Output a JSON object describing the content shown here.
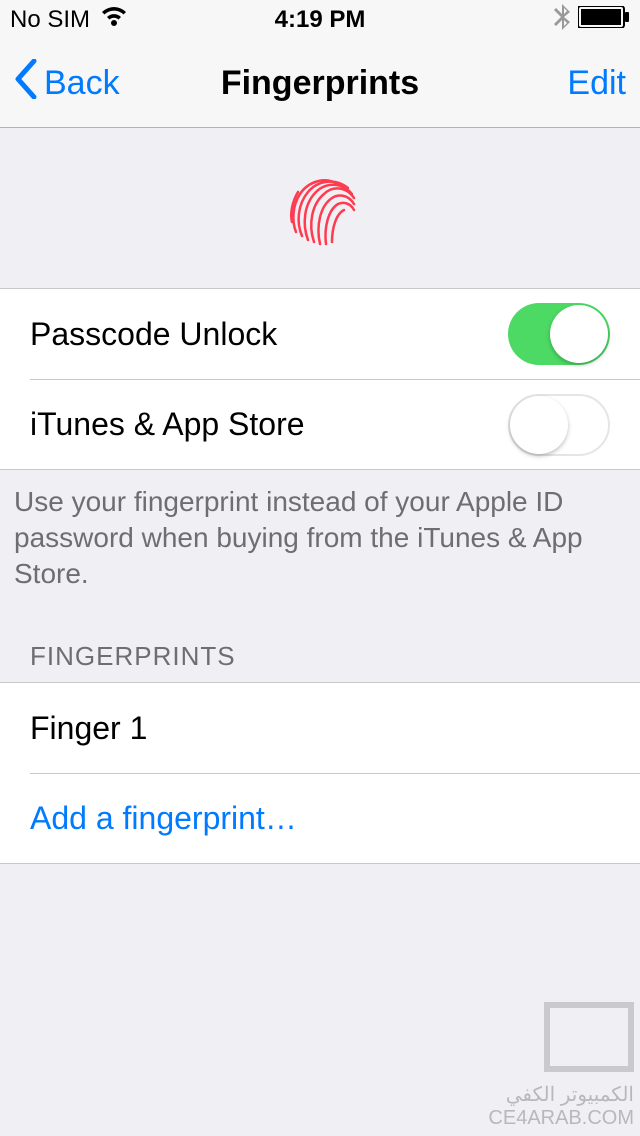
{
  "status": {
    "carrier": "No SIM",
    "time": "4:19 PM"
  },
  "nav": {
    "back": "Back",
    "title": "Fingerprints",
    "edit": "Edit"
  },
  "settings": {
    "passcode_unlock_label": "Passcode Unlock",
    "passcode_unlock_on": true,
    "itunes_label": "iTunes & App Store",
    "itunes_on": false,
    "footer": "Use your fingerprint instead of your Apple ID password when buying from the iTunes & App Store."
  },
  "fingerprints": {
    "section_header": "FINGERPRINTS",
    "items": [
      "Finger 1"
    ],
    "add_label": "Add a fingerprint…"
  },
  "watermark": {
    "line1": "الكمبيوتر الكفي",
    "line2": "CE4ARAB.COM"
  }
}
